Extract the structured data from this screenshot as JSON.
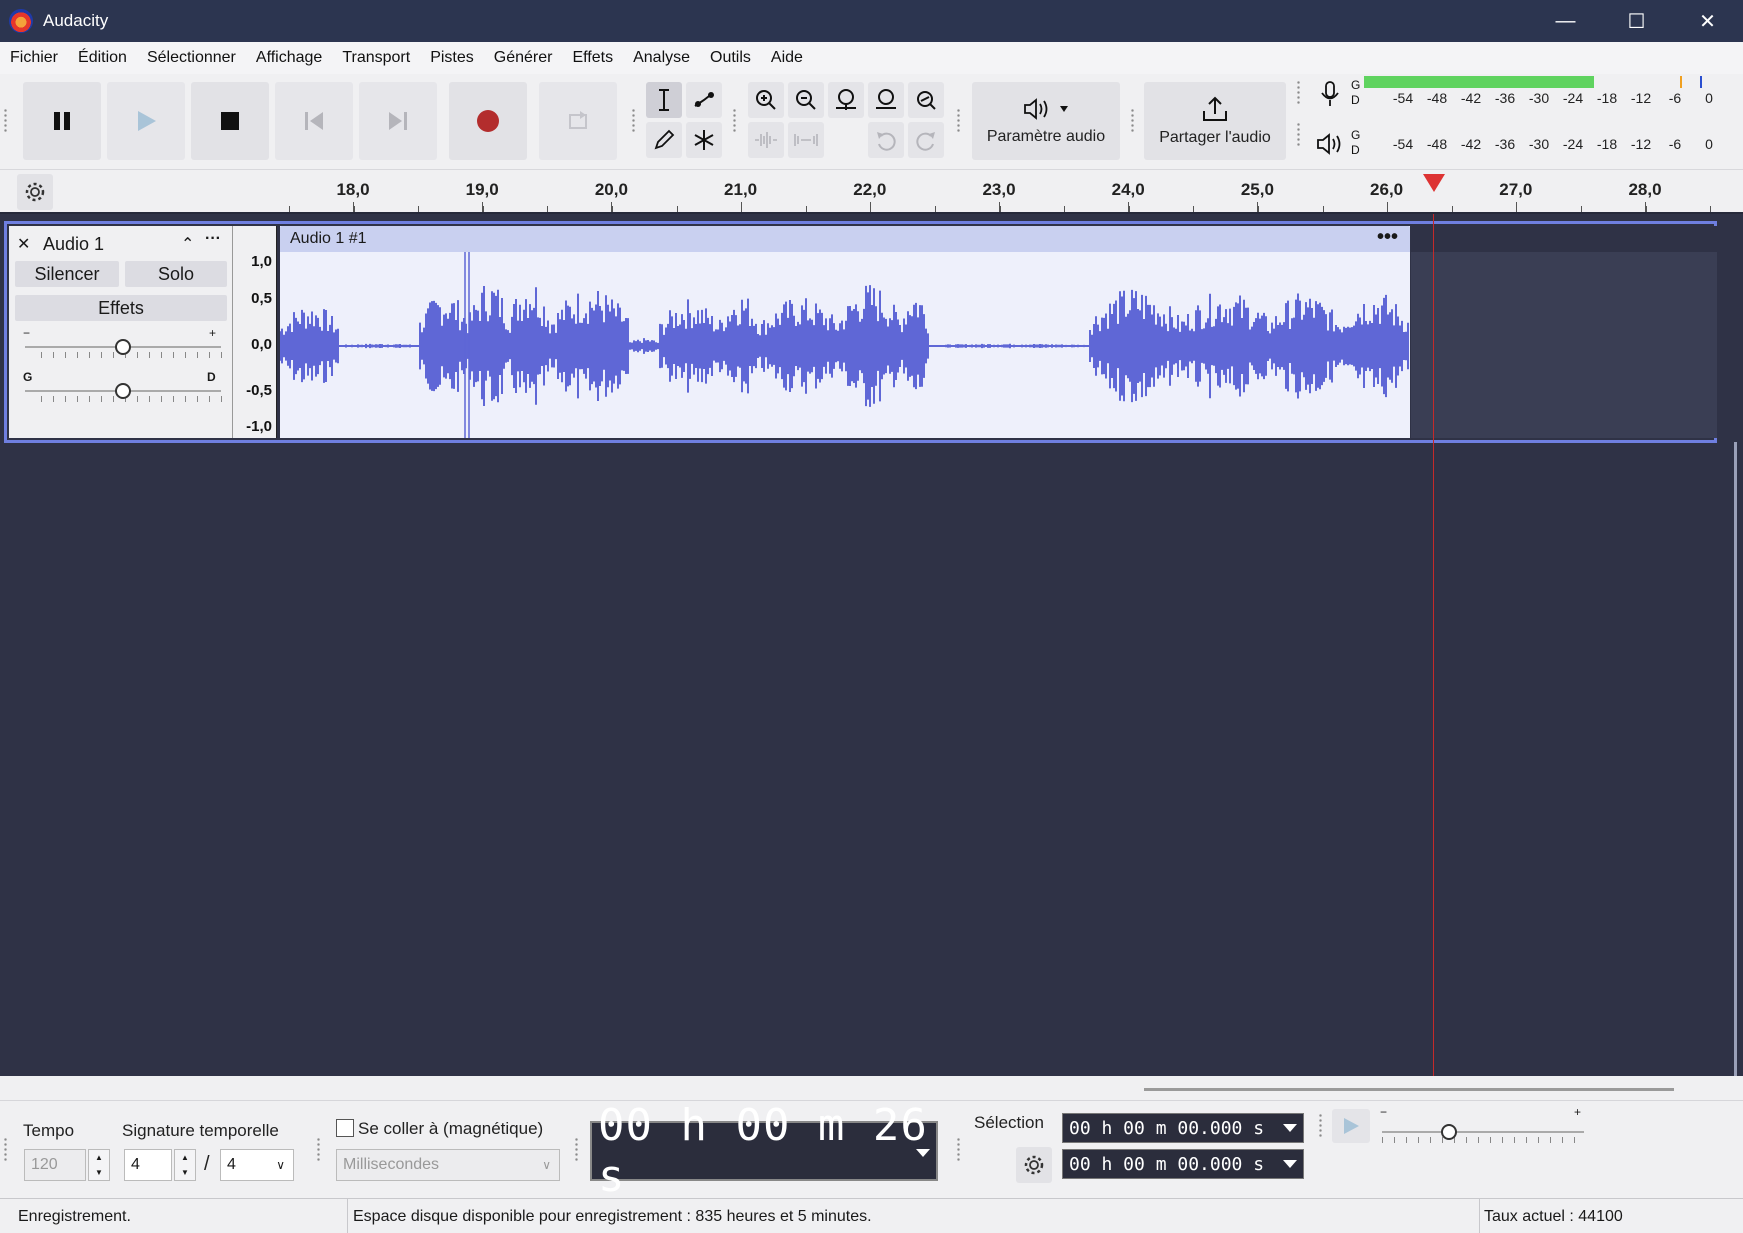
{
  "window": {
    "title": "Audacity",
    "minimize": "—",
    "maximize": "☐",
    "close": "✕"
  },
  "menu": [
    "Fichier",
    "Édition",
    "Sélectionner",
    "Affichage",
    "Transport",
    "Pistes",
    "Générer",
    "Effets",
    "Analyse",
    "Outils",
    "Aide"
  ],
  "toolbar": {
    "audio_setup_label": "Paramètre audio",
    "share_audio_label": "Partager l'audio",
    "meter_g": "G",
    "meter_d": "D",
    "record_meter_scale": [
      "-54",
      "-48",
      "-42",
      "-36",
      "-30",
      "-24",
      "-18",
      "-12",
      "-6",
      "0"
    ],
    "playback_meter_scale": [
      "-54",
      "-48",
      "-42",
      "-36",
      "-30",
      "-24",
      "-18",
      "-12",
      "-6",
      "0"
    ],
    "record_level_fraction": 0.66,
    "colors": {
      "record_meter": "#5fd35f",
      "record_button": "#c0392b"
    }
  },
  "ruler": {
    "ticks": [
      "18,0",
      "19,0",
      "20,0",
      "21,0",
      "22,0",
      "23,0",
      "24,0",
      "25,0",
      "26,0",
      "27,0",
      "28,0"
    ],
    "playhead_seconds": 26.37
  },
  "track": {
    "name": "Audio 1",
    "close_icon": "✕",
    "collapse_icon": "⌃",
    "menu_icon": "···",
    "mute_label": "Silencer",
    "solo_label": "Solo",
    "effects_label": "Effets",
    "gain_minus": "−",
    "gain_plus": "+",
    "pan_left": "G",
    "pan_right": "D",
    "gain_value_fraction": 0.5,
    "pan_value_fraction": 0.5,
    "scale_labels": [
      "1,0",
      "0,5",
      "0,0",
      "-0,5",
      "-1,0"
    ],
    "clip_name": "Audio 1 #1",
    "clip_menu": "•••",
    "waveform_color": "#5f67d6"
  },
  "bottom": {
    "tempo_label": "Tempo",
    "tempo_value": "120",
    "time_sig_label": "Signature temporelle",
    "time_sig_num": "4",
    "time_sig_sep": "/",
    "time_sig_den": "4",
    "snap_label": "Se coller à (magnétique)",
    "snap_unit": "Millisecondes",
    "time_display": "00 h 00 m 26 s",
    "selection_label": "Sélection",
    "selection_start": "00 h 00 m 00.000 s",
    "selection_end": "00 h 00 m 00.000 s",
    "speed_minus": "−",
    "speed_plus": "+",
    "speed_value_fraction": 0.33
  },
  "status": {
    "state": "Enregistrement.",
    "disk": "Espace disque disponible pour enregistrement : 835 heures et 5 minutes.",
    "rate": "Taux actuel : 44100"
  }
}
